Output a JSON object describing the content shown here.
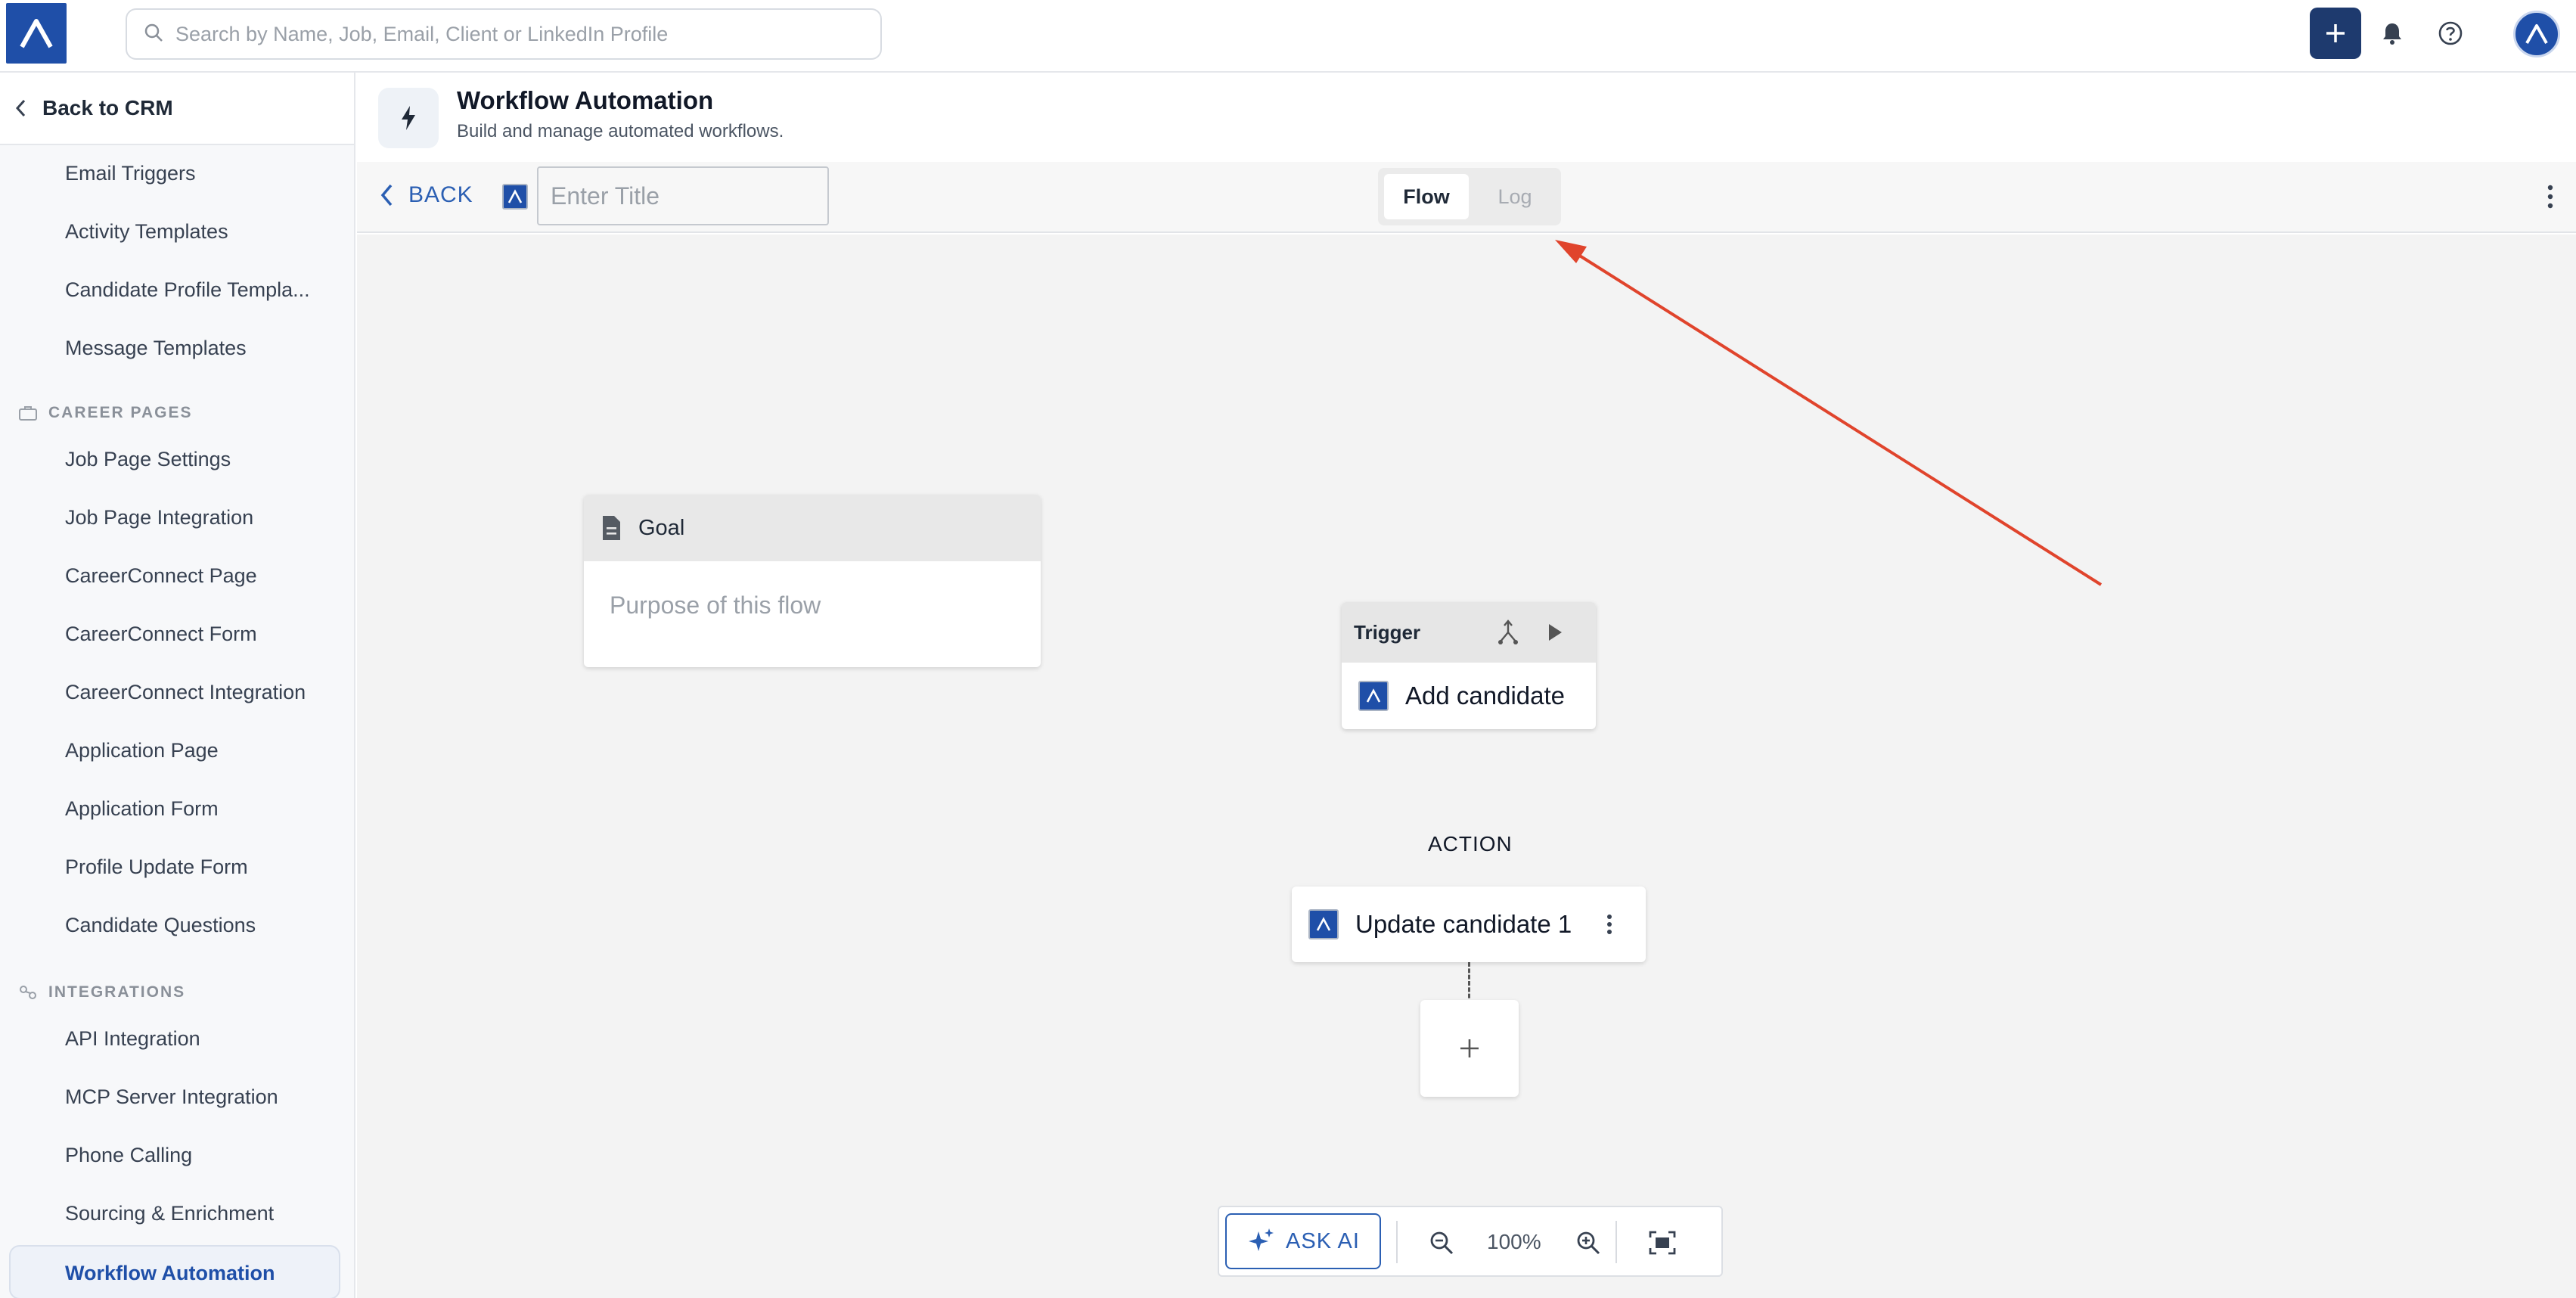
{
  "topbar": {
    "search_placeholder": "Search by Name, Job, Email, Client or LinkedIn Profile",
    "icons": [
      "logo-icon",
      "search-icon",
      "plus-icon",
      "bell-icon",
      "help-icon",
      "avatar-logo-icon"
    ]
  },
  "sidebar": {
    "back_label": "Back to CRM",
    "items_top": [
      "Email Triggers",
      "Activity Templates",
      "Candidate Profile Templa...",
      "Message Templates"
    ],
    "section_career": "CAREER PAGES",
    "career_items": [
      "Job Page Settings",
      "Job Page Integration",
      "CareerConnect Page",
      "CareerConnect Form",
      "CareerConnect Integration",
      "Application Page",
      "Application Form",
      "Profile Update Form",
      "Candidate Questions"
    ],
    "section_integrations": "INTEGRATIONS",
    "integration_items": [
      "API Integration",
      "MCP Server Integration",
      "Phone Calling",
      "Sourcing & Enrichment",
      "Workflow Automation"
    ]
  },
  "header": {
    "title": "Workflow Automation",
    "subtitle": "Build and manage automated workflows."
  },
  "toolbar": {
    "back_label": "BACK",
    "title_placeholder": "Enter Title",
    "tab_flow": "Flow",
    "tab_log": "Log",
    "active_tab": "Flow"
  },
  "canvas": {
    "goal_title": "Goal",
    "goal_placeholder": "Purpose of this flow",
    "trigger_title": "Trigger",
    "trigger_action": "Add candidate",
    "action_section": "ACTION",
    "action_item": "Update candidate 1"
  },
  "bottom_bar": {
    "ask_ai_label": "ASK AI",
    "zoom": "100%"
  },
  "colors": {
    "brand": "#1f4fa8",
    "brand_dark": "#1e3a6e",
    "link": "#2b5fb3",
    "annotation_arrow": "#e0442c"
  }
}
